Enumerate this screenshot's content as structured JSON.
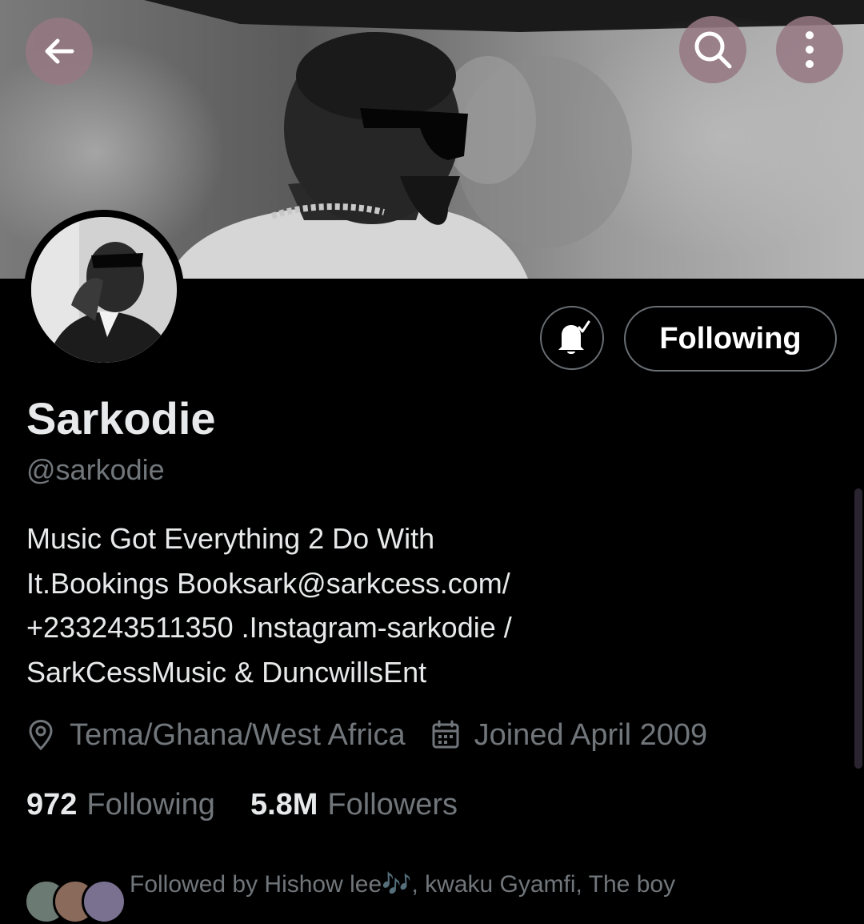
{
  "header": {
    "back_icon": "arrow-left-icon",
    "search_icon": "search-icon",
    "more_icon": "more-vertical-icon",
    "button_color": "#967882"
  },
  "profile": {
    "name": "Sarkodie",
    "handle": "@sarkodie",
    "bio_lines": [
      "Music Got Everything 2 Do With",
      "It.Bookings Booksark@sarkcess.com/",
      "+233243511350 .Instagram-sarkodie /",
      "SarkCessMusic & DuncwillsEnt"
    ],
    "location": "Tema/Ghana/West Africa",
    "joined": "Joined April 2009",
    "following_count": "972",
    "following_label": "Following",
    "followers_count": "5.8M",
    "followers_label": "Followers",
    "followed_by": "Followed by Hishow lee🎶, kwaku Gyamfi, The boy"
  },
  "actions": {
    "notify_icon": "bell-check-icon",
    "follow_button_label": "Following"
  },
  "colors": {
    "background": "#000000",
    "primary_text": "#e7e9ea",
    "secondary_text": "#71767b",
    "button_border": "#6a6f74"
  }
}
